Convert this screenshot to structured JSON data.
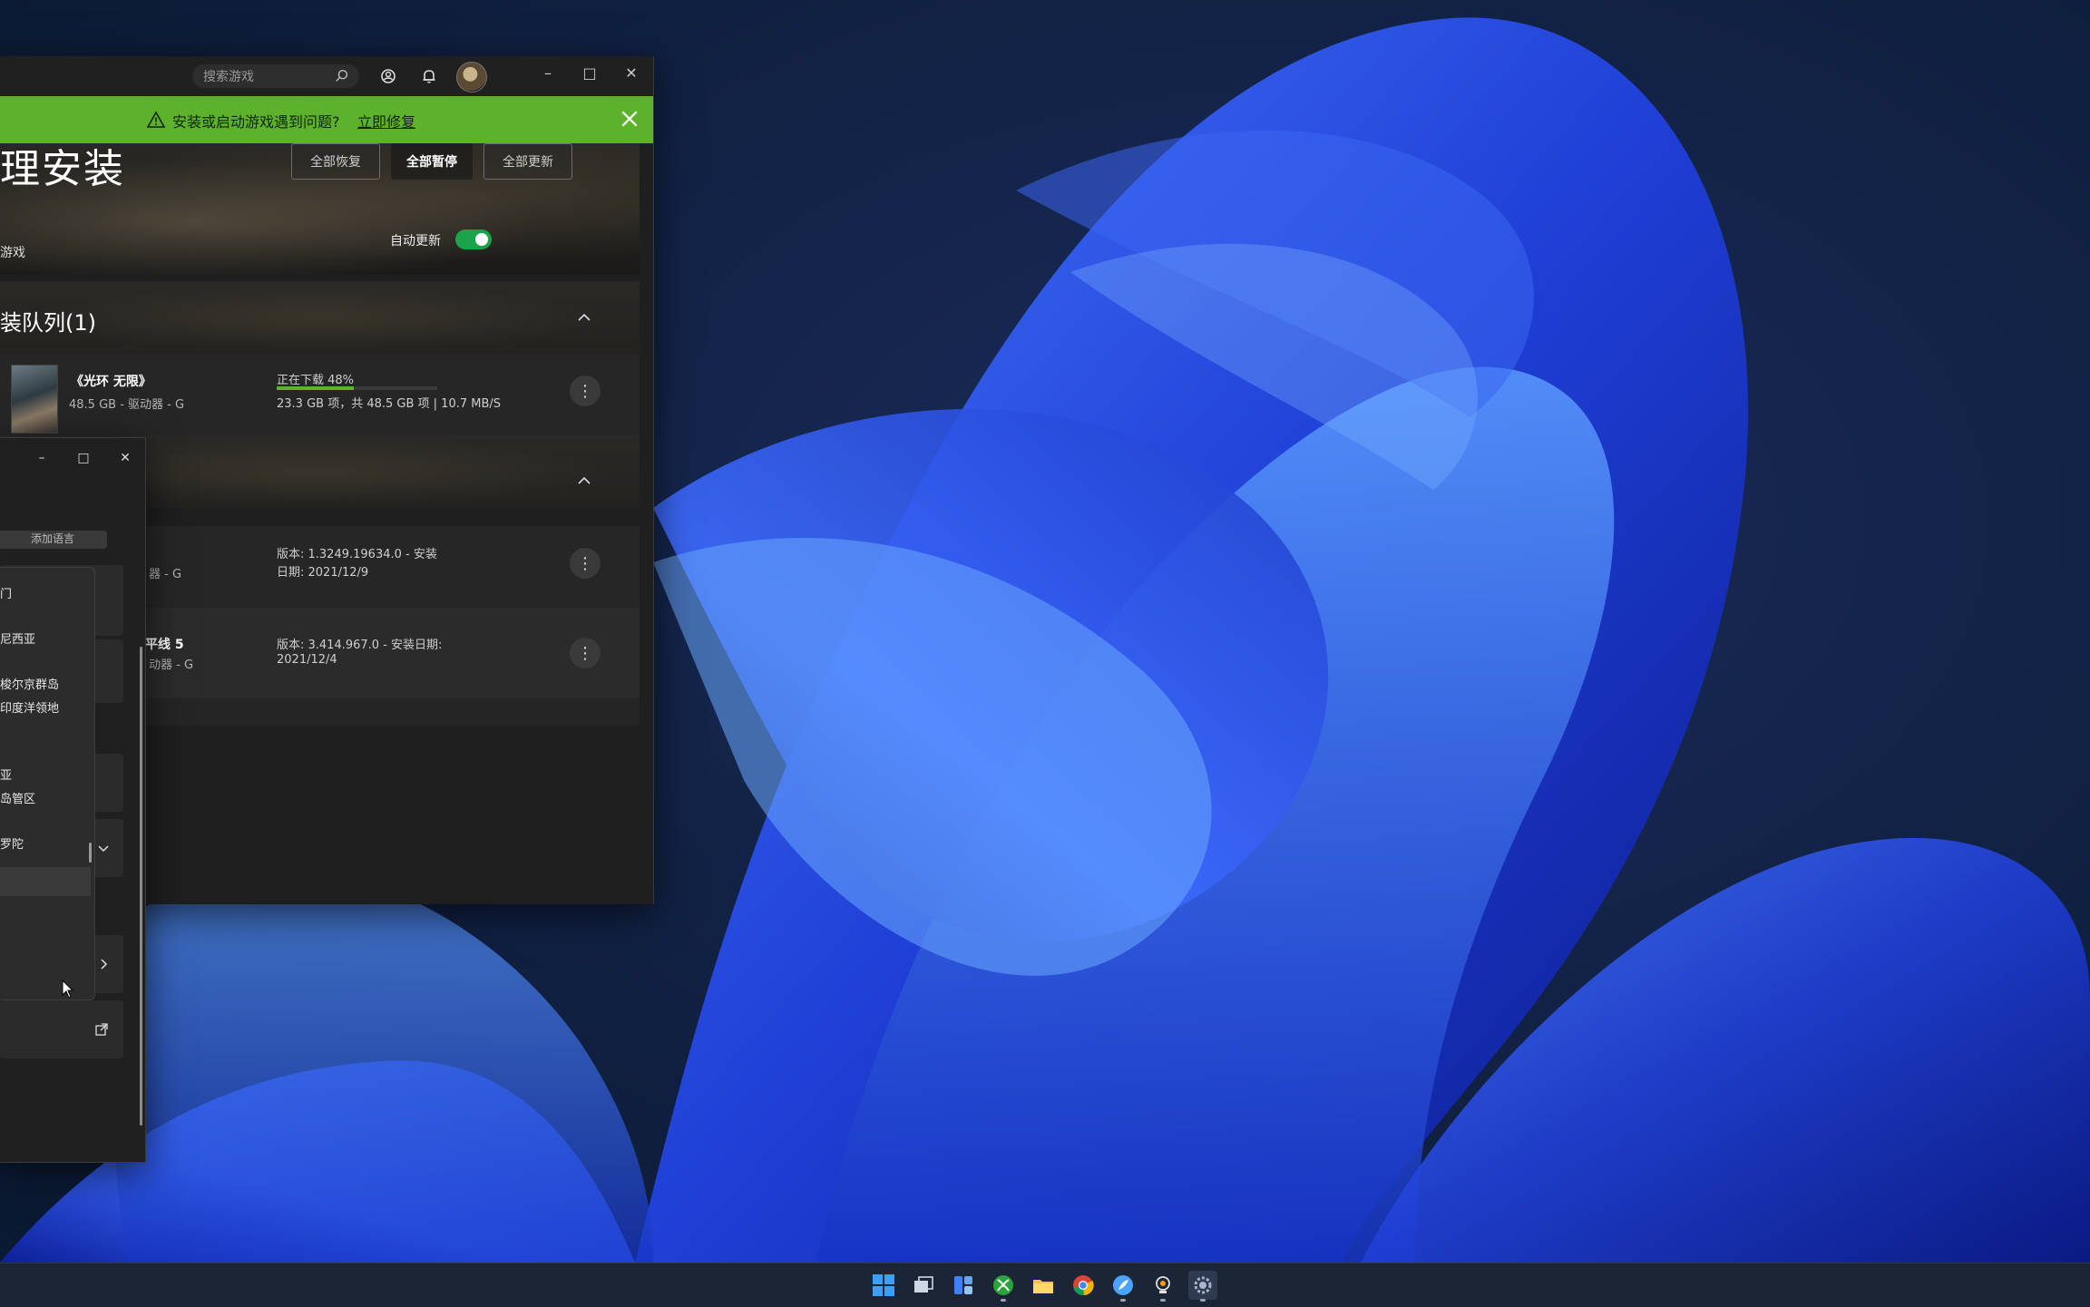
{
  "xbox": {
    "search_placeholder": "搜索游戏",
    "banner": {
      "text": "安装或启动游戏遇到问题?",
      "link": "立即修复"
    },
    "page_title": "理安装",
    "buttons": {
      "resume_all": "全部恢复",
      "pause_all": "全部暂停",
      "update_all": "全部更新"
    },
    "hero_subtitle": "游戏",
    "auto_update_label": "自动更新",
    "queue_title": "装队列(1)",
    "queue_items": [
      {
        "title": "《光环 无限》",
        "meta": "48.5 GB - 驱动器 - G",
        "status": "正在下载 48%",
        "progress_percent": 48,
        "detail": "23.3 GB 项，共 48.5 GB 项 | 10.7 MB/S"
      }
    ],
    "installed_items": [
      {
        "title": "",
        "meta": "器 - G",
        "version": "版本: 1.3249.19634.0 - 安装",
        "date": "日期: 2021/12/9"
      },
      {
        "title": "平线 5",
        "meta": "动器 - G",
        "version": "版本: 3.414.967.0 - 安装日期:",
        "date": "2021/12/4"
      }
    ]
  },
  "settings": {
    "dropdown_add": "添加语言",
    "dropdown_items": [
      "门",
      "尼西亚",
      "梭尔京群岛",
      "印度洋领地",
      "亚",
      "岛管区",
      "罗陀"
    ]
  },
  "taskbar": {
    "apps": [
      "start-icon",
      "task-view-icon",
      "widgets-icon",
      "xbox-icon",
      "file-explorer-icon",
      "chrome-icon",
      "feather-app-icon",
      "game-bar-icon",
      "settings-icon"
    ]
  },
  "colors": {
    "accent_green": "#5db22c",
    "toggle_on": "#1aa34a",
    "wallpaper_blue": "#1f3fd6"
  }
}
